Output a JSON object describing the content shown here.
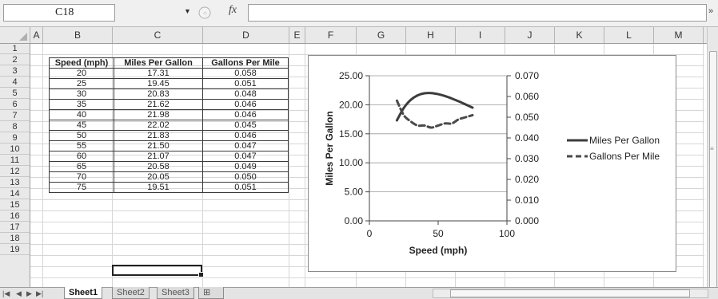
{
  "formula_bar": {
    "cell_reference": "C18",
    "fx_label": "fx",
    "formula_value": ""
  },
  "columns": [
    "A",
    "B",
    "C",
    "D",
    "E",
    "F",
    "G",
    "H",
    "I",
    "J",
    "K",
    "L",
    "M"
  ],
  "rows": [
    "1",
    "2",
    "3",
    "4",
    "5",
    "6",
    "7",
    "8",
    "9",
    "10",
    "11",
    "12",
    "13",
    "14",
    "15",
    "16",
    "17",
    "18",
    "19"
  ],
  "table": {
    "headers": [
      "Speed (mph)",
      "Miles Per Gallon",
      "Gallons Per Mile"
    ],
    "rows": [
      [
        "20",
        "17.31",
        "0.058"
      ],
      [
        "25",
        "19.45",
        "0.051"
      ],
      [
        "30",
        "20.83",
        "0.048"
      ],
      [
        "35",
        "21.62",
        "0.046"
      ],
      [
        "40",
        "21.98",
        "0.046"
      ],
      [
        "45",
        "22.02",
        "0.045"
      ],
      [
        "50",
        "21.83",
        "0.046"
      ],
      [
        "55",
        "21.50",
        "0.047"
      ],
      [
        "60",
        "21.07",
        "0.047"
      ],
      [
        "65",
        "20.58",
        "0.049"
      ],
      [
        "70",
        "20.05",
        "0.050"
      ],
      [
        "75",
        "19.51",
        "0.051"
      ]
    ]
  },
  "chart_data": {
    "type": "line",
    "title": "",
    "xlabel": "Speed (mph)",
    "ylabel": "Miles Per Gallon",
    "xlim": [
      0,
      100
    ],
    "ylim": [
      0,
      25
    ],
    "y2lim": [
      0,
      0.07
    ],
    "x_ticks": [
      "0",
      "50",
      "100"
    ],
    "y_ticks": [
      "0.00",
      "5.00",
      "10.00",
      "15.00",
      "20.00",
      "25.00"
    ],
    "y2_ticks": [
      "0.000",
      "0.010",
      "0.020",
      "0.030",
      "0.040",
      "0.050",
      "0.060",
      "0.070"
    ],
    "legend_position": "right",
    "x": [
      20,
      25,
      30,
      35,
      40,
      45,
      50,
      55,
      60,
      65,
      70,
      75
    ],
    "series": [
      {
        "name": "Miles Per Gallon",
        "axis": "left",
        "style": "solid",
        "color": "#3c3c3c",
        "values": [
          17.31,
          19.45,
          20.83,
          21.62,
          21.98,
          22.02,
          21.83,
          21.5,
          21.07,
          20.58,
          20.05,
          19.51
        ]
      },
      {
        "name": "Gallons Per Mile",
        "axis": "right",
        "style": "dashed",
        "color": "#4a4a4a",
        "values": [
          0.058,
          0.051,
          0.048,
          0.046,
          0.046,
          0.045,
          0.046,
          0.047,
          0.047,
          0.049,
          0.05,
          0.051
        ]
      }
    ]
  },
  "sheet_tabs": [
    "Sheet1",
    "Sheet2",
    "Sheet3"
  ],
  "active_sheet": "Sheet1"
}
